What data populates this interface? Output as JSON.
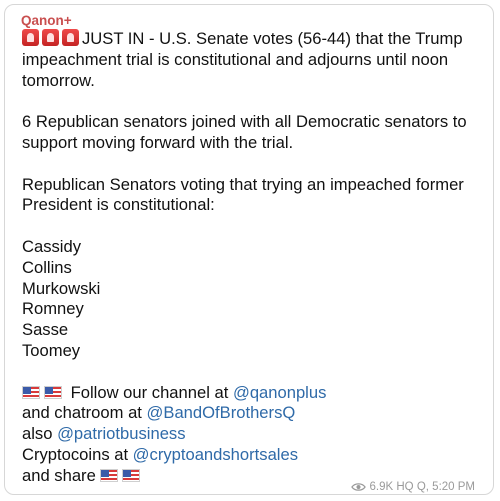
{
  "channel": {
    "name": "Qanon+"
  },
  "message": {
    "line1": "JUST IN - U.S. Senate votes (56-44) that the Trump",
    "line2": "impeachment trial is constitutional and adjourns until noon",
    "line3": "tomorrow.",
    "line4": "6 Republican senators joined with all Democratic senators to",
    "line5": "support moving forward with the trial.",
    "line6": "Republican Senators voting that trying an impeached former",
    "line7": "President is constitutional:",
    "senators": [
      "Cassidy",
      "Collins",
      "Murkowski",
      "Romney",
      "Sasse",
      "Toomey"
    ],
    "follow_text": "Follow our channel at ",
    "channel_link": "@qanonplus",
    "chatroom_text": "and chatroom at ",
    "chatroom_link": "@BandOfBrothersQ",
    "also_text": "also ",
    "also_link": "@patriotbusiness",
    "crypto_text": "Cryptocoins at ",
    "crypto_link": "@cryptoandshortsales",
    "share_text": "and share"
  },
  "footer": {
    "views": "6.9K",
    "author": "HQ Q,",
    "time": "5:20 PM"
  },
  "icons": {
    "siren": "police-siren-emoji",
    "flag": "us-flag-emoji",
    "views": "eye-icon"
  },
  "colors": {
    "channel": "#c94f4f",
    "link": "#2f6aa8",
    "meta": "#9a9a9a"
  }
}
